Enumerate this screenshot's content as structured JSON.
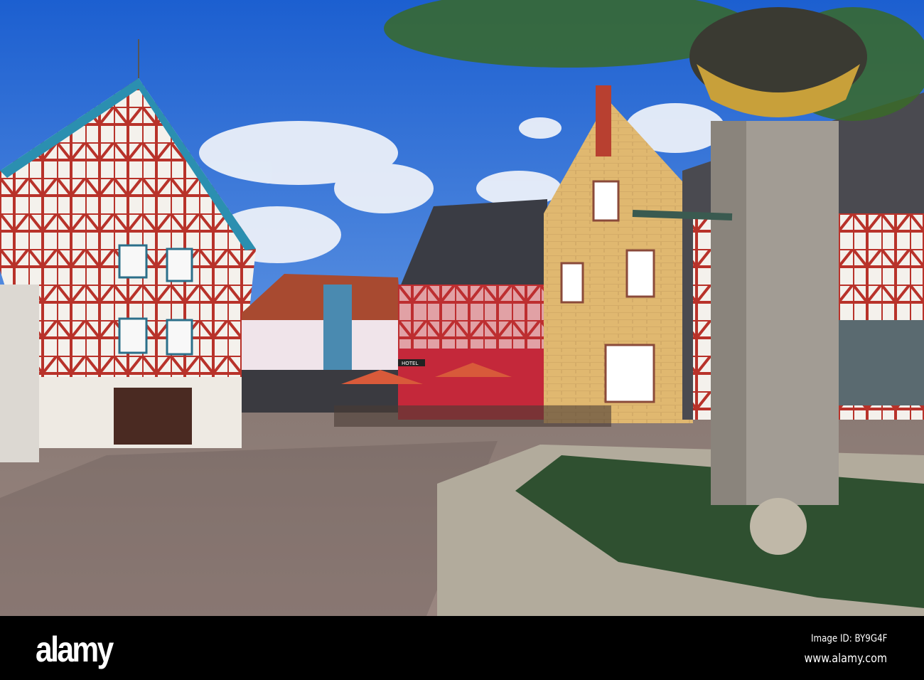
{
  "photo": {
    "hotel_sign": "HOTEL"
  },
  "footer": {
    "logo": "alamy",
    "image_id": "Image ID: BY9G4F",
    "website": "www.alamy.com"
  },
  "colors": {
    "sky": "#2a6fd6",
    "timber_red": "#b8322a",
    "footer_bg": "#000000"
  }
}
